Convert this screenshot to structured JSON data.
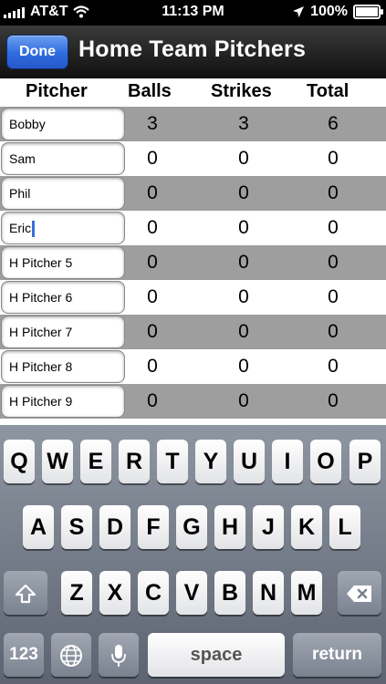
{
  "status_bar": {
    "carrier": "AT&T",
    "time": "11:13 PM",
    "battery": "100%",
    "icons": [
      "signal-icon",
      "wifi-icon",
      "location-arrow-icon",
      "battery-icon"
    ]
  },
  "nav": {
    "done_label": "Done",
    "title": "Home Team Pitchers"
  },
  "table": {
    "headers": {
      "pitcher": "Pitcher",
      "balls": "Balls",
      "strikes": "Strikes",
      "total": "Total"
    },
    "rows": [
      {
        "name": "Bobby",
        "balls": "3",
        "strikes": "3",
        "total": "6"
      },
      {
        "name": "Sam",
        "balls": "0",
        "strikes": "0",
        "total": "0"
      },
      {
        "name": "Phil",
        "balls": "0",
        "strikes": "0",
        "total": "0"
      },
      {
        "name": "Eric",
        "balls": "0",
        "strikes": "0",
        "total": "0"
      },
      {
        "name": "H Pitcher 5",
        "balls": "0",
        "strikes": "0",
        "total": "0"
      },
      {
        "name": "H Pitcher 6",
        "balls": "0",
        "strikes": "0",
        "total": "0"
      },
      {
        "name": "H Pitcher 7",
        "balls": "0",
        "strikes": "0",
        "total": "0"
      },
      {
        "name": "H Pitcher 8",
        "balls": "0",
        "strikes": "0",
        "total": "0"
      },
      {
        "name": "H Pitcher 9",
        "balls": "0",
        "strikes": "0",
        "total": "0"
      }
    ]
  },
  "keyboard": {
    "row1": [
      "Q",
      "W",
      "E",
      "R",
      "T",
      "Y",
      "U",
      "I",
      "O",
      "P"
    ],
    "row2": [
      "A",
      "S",
      "D",
      "F",
      "G",
      "H",
      "J",
      "K",
      "L"
    ],
    "row3": [
      "Z",
      "X",
      "C",
      "V",
      "B",
      "N",
      "M"
    ],
    "numbers_label": "123",
    "space_label": "space",
    "return_label": "return"
  },
  "colors": {
    "done_button": "#2f6be0",
    "gray_row": "#9e9e9e",
    "cursor": "#3b6ed9"
  }
}
